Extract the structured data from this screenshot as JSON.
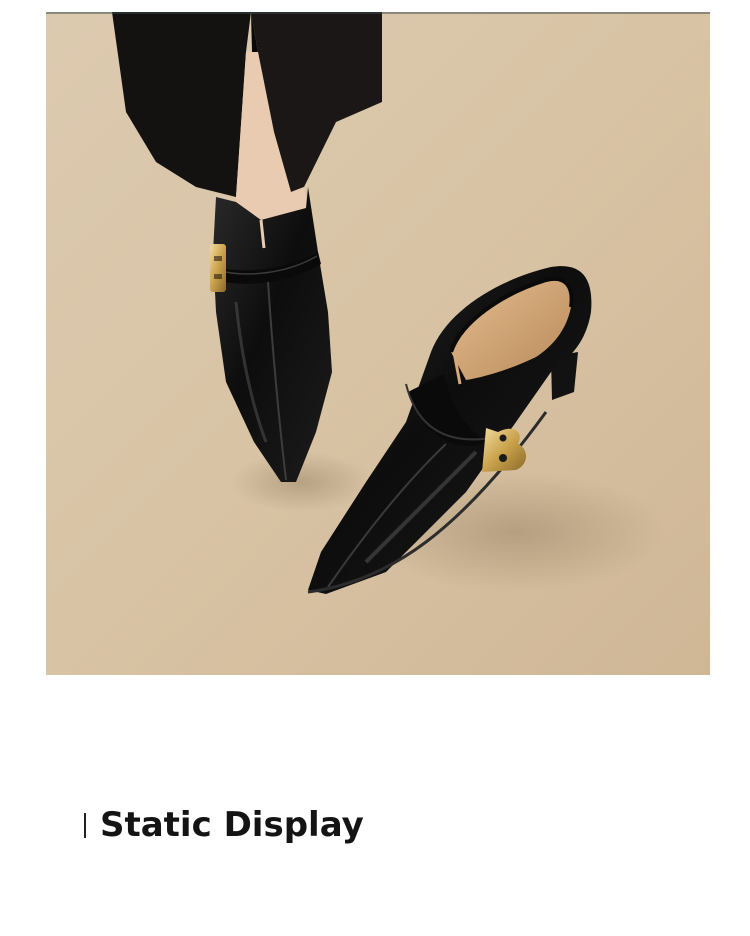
{
  "photo": {
    "icon": "product-photo-black-pointed-toe-shoes",
    "background_color": "#d9c6a8",
    "shoe_color": "#111111",
    "buckle_color": "#c9a24b"
  },
  "section": {
    "title": "Static Display"
  }
}
